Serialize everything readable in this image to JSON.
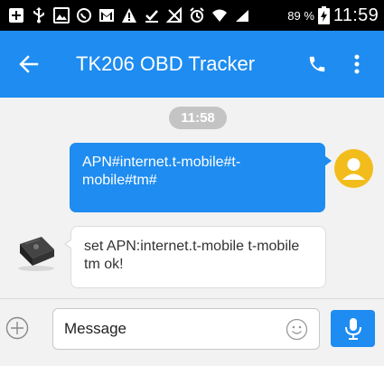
{
  "status_bar": {
    "icons": [
      "add-box-icon",
      "usb-icon",
      "image-icon",
      "whatsapp-icon",
      "gmail-icon",
      "warning-icon",
      "download-done-icon",
      "no-signal-icon",
      "alarm-icon",
      "wifi-icon",
      "cell-signal-icon"
    ],
    "battery_percent": "89 %",
    "time": "11:59"
  },
  "app_bar": {
    "title": "TK206 OBD Tracker",
    "back_icon": "arrow-back-icon",
    "call_icon": "phone-icon",
    "menu_icon": "more-vert-icon",
    "color": "#1e8cf0"
  },
  "chat": {
    "timestamp": "11:58",
    "messages": [
      {
        "direction": "outgoing",
        "text": "APN#internet.t-mobile#t-mobile#tm#",
        "avatar": "user-avatar"
      },
      {
        "direction": "incoming",
        "text": "set APN:internet.t-mobile  t-mobile tm  ok!",
        "avatar": "obd-device-avatar"
      }
    ]
  },
  "composer": {
    "placeholder": "Message",
    "value": "",
    "plus_icon": "add-circle-icon",
    "emoji_icon": "emoji-icon",
    "mic_icon": "mic-icon"
  }
}
